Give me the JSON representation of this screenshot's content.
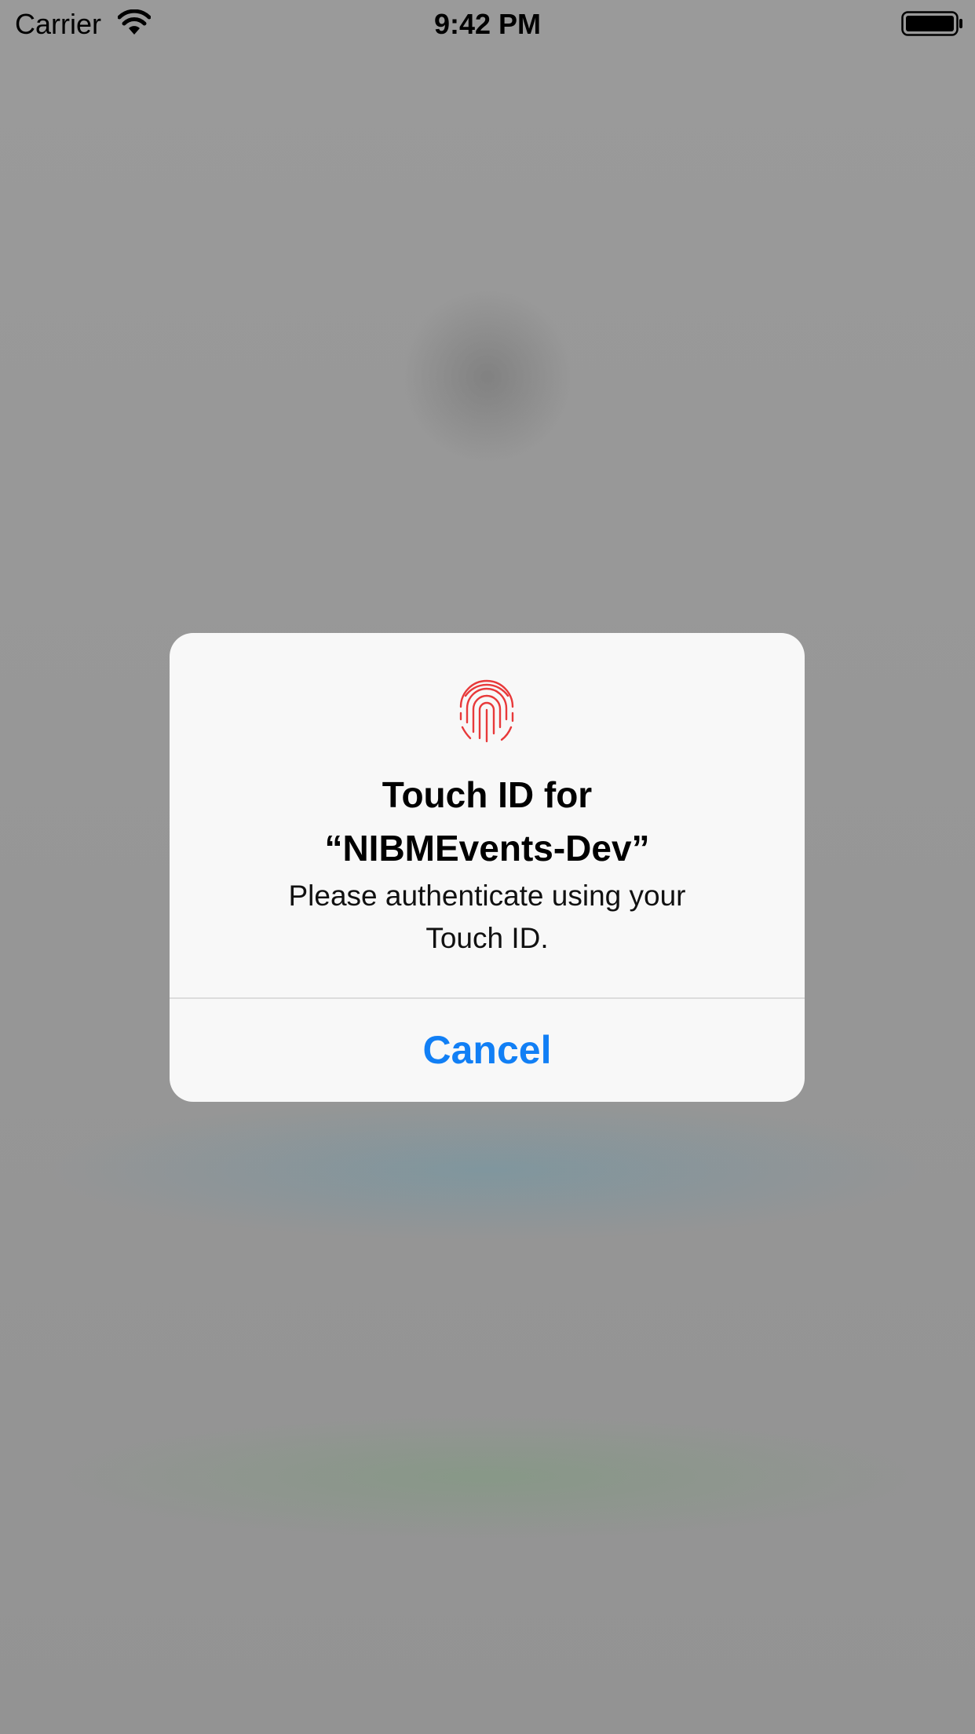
{
  "status_bar": {
    "carrier": "Carrier",
    "time": "9:42 PM",
    "icons": [
      "wifi-icon",
      "battery-icon"
    ]
  },
  "alert": {
    "icon": "fingerprint-icon",
    "title_line_1": "Touch ID for",
    "title_line_2": "“NIBMEvents-Dev”",
    "message_line_1": "Please authenticate using your",
    "message_line_2": "Touch ID.",
    "cancel_label": "Cancel"
  },
  "colors": {
    "fingerprint": "#e8393a",
    "action": "#117ff5",
    "alert_background": "#f8f8f8",
    "dimmed_background": "#959595"
  }
}
